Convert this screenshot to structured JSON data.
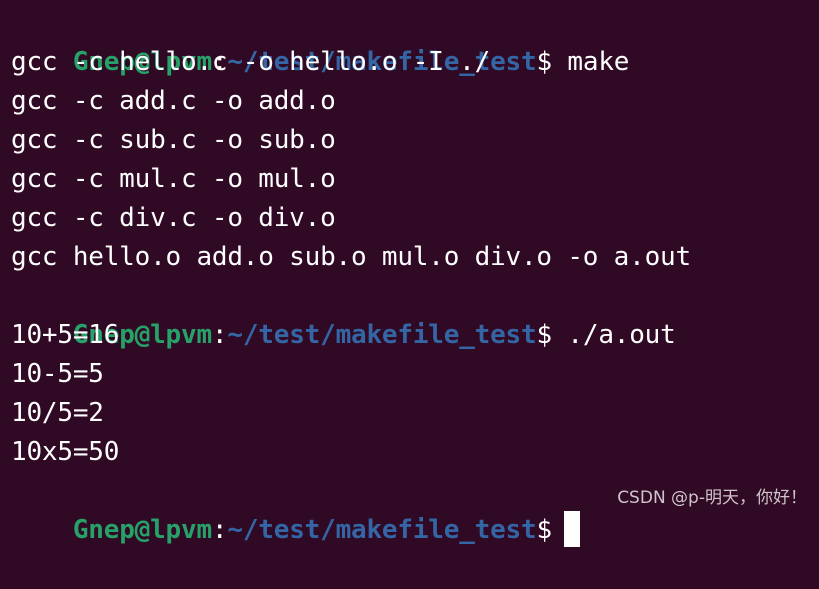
{
  "terminal": {
    "prompt": {
      "user_host": "Gnep@lpvm",
      "colon": ":",
      "path": "~/test/makefile_test",
      "dollar": "$"
    },
    "commands": [
      "make",
      "./a.out",
      ""
    ],
    "make_output": [
      "gcc -c hello.c -o hello.o -I ./",
      "gcc -c add.c -o add.o",
      "gcc -c sub.c -o sub.o",
      "gcc -c mul.c -o mul.o",
      "gcc -c div.c -o div.o",
      "gcc hello.o add.o sub.o mul.o div.o -o a.out"
    ],
    "program_output": [
      "10+5=16",
      "10-5=5",
      "10/5=2",
      "10x5=50"
    ]
  },
  "watermark": "CSDN @p-明天，你好！",
  "colors": {
    "background": "#300a24",
    "user_host": "#26a269",
    "path": "#3465a4",
    "text": "#ffffff"
  }
}
